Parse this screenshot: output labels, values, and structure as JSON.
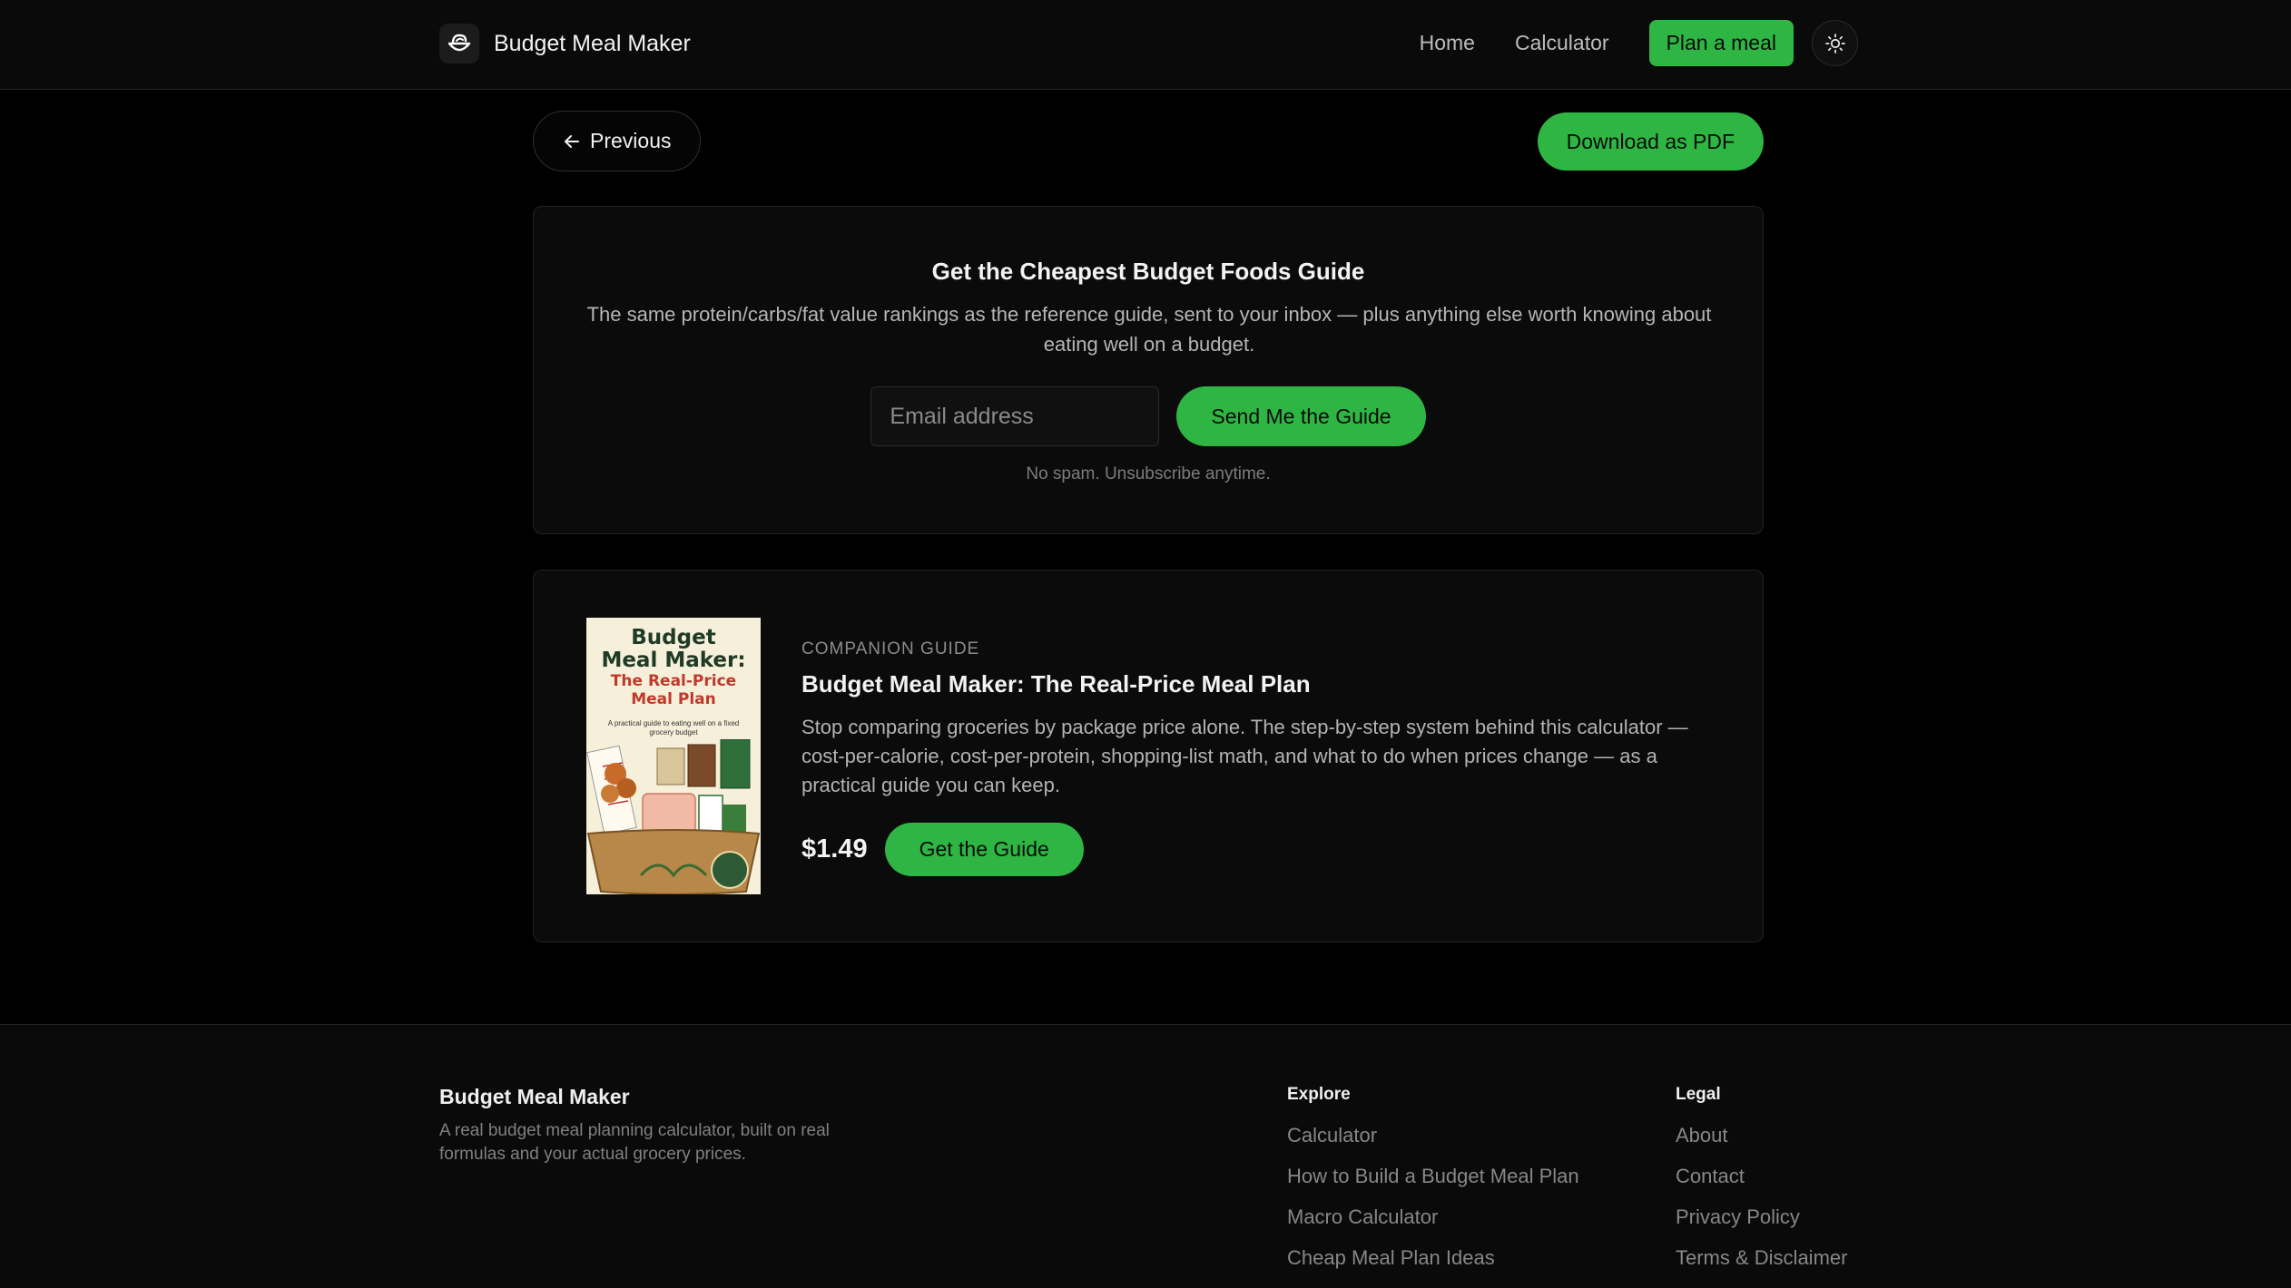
{
  "header": {
    "brand": "Budget Meal Maker",
    "nav": {
      "home": "Home",
      "calculator": "Calculator",
      "cta": "Plan a meal"
    }
  },
  "actions": {
    "previous": "Previous",
    "download": "Download as PDF"
  },
  "signup": {
    "title": "Get the Cheapest Budget Foods Guide",
    "text": "The same protein/carbs/fat value rankings as the reference guide, sent to your inbox — plus anything else worth knowing about eating well on a budget.",
    "email_placeholder": "Email address",
    "button": "Send Me the Guide",
    "note": "No spam. Unsubscribe anytime."
  },
  "product": {
    "cover": {
      "title_line1": "Budget",
      "title_line2": "Meal Maker:",
      "subtitle_line1": "The Real-Price",
      "subtitle_line2": "Meal Plan",
      "tagline": "A practical guide to eating well on a fixed grocery budget"
    },
    "kicker": "COMPANION GUIDE",
    "title": "Budget Meal Maker: The Real-Price Meal Plan",
    "description": "Stop comparing groceries by package price alone. The step-by-step system behind this calculator — cost-per-calorie, cost-per-protein, shopping-list math, and what to do when prices change — as a practical guide you can keep.",
    "price": "$1.49",
    "button": "Get the Guide"
  },
  "footer": {
    "brand": "Budget Meal Maker",
    "description": "A real budget meal planning calculator, built on real formulas and your actual grocery prices.",
    "explore": {
      "heading": "Explore",
      "links": [
        "Calculator",
        "How to Build a Budget Meal Plan",
        "Macro Calculator",
        "Cheap Meal Plan Ideas"
      ]
    },
    "legal": {
      "heading": "Legal",
      "links": [
        "About",
        "Contact",
        "Privacy Policy",
        "Terms & Disclaimer"
      ]
    }
  },
  "colors": {
    "accent": "#2fb544",
    "background": "#000000",
    "card": "#0b0b0b"
  }
}
